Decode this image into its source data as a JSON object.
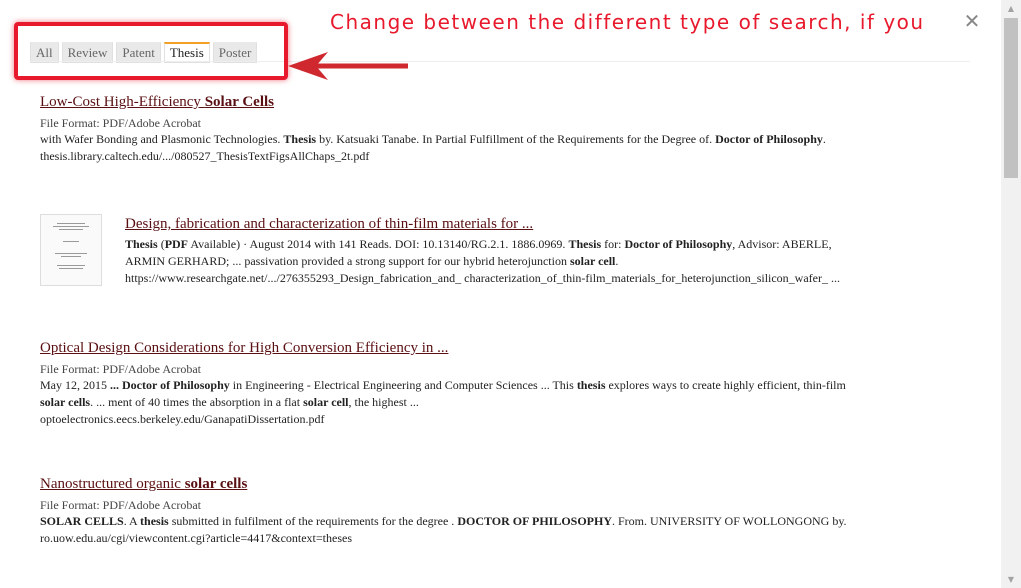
{
  "tabs": [
    {
      "label": "All",
      "active": false
    },
    {
      "label": "Review",
      "active": false
    },
    {
      "label": "Patent",
      "active": false
    },
    {
      "label": "Thesis",
      "active": true
    },
    {
      "label": "Poster",
      "active": false
    }
  ],
  "callout": {
    "text": "Change between the different type of search, if you",
    "color": "#e8192c"
  },
  "close_label": "✕",
  "results": [
    {
      "title_runs": [
        {
          "text": "Low-Cost High-Efficiency ",
          "bold": false
        },
        {
          "text": "Solar Cells",
          "bold": true
        }
      ],
      "format": "File Format: PDF/Adobe Acrobat",
      "snippet_lines": [
        [
          {
            "text": "with Wafer Bonding and Plasmonic Technologies. ",
            "bold": false
          },
          {
            "text": "Thesis",
            "bold": true
          },
          {
            "text": " by. Katsuaki Tanabe. In Partial Fulfillment of the Requirements for the Degree of. ",
            "bold": false
          },
          {
            "text": "Doctor of Philosophy",
            "bold": true
          },
          {
            "text": ".",
            "bold": false
          }
        ]
      ],
      "url": "thesis.library.caltech.edu/.../080527_ThesisTextFigsAllChaps_2t.pdf"
    },
    {
      "title_runs": [
        {
          "text": "Design, fabrication and characterization of thin-film materials for ...",
          "bold": false
        }
      ],
      "format": "",
      "has_thumbnail": true,
      "snippet_lines": [
        [
          {
            "text": "Thesis",
            "bold": true
          },
          {
            "text": " (",
            "bold": false
          },
          {
            "text": "PDF",
            "bold": true
          },
          {
            "text": " Available) · August 2014 with 141 Reads. DOI: 10.13140/RG.2.1. 1886.0969. ",
            "bold": false
          },
          {
            "text": "Thesis",
            "bold": true
          },
          {
            "text": " for: ",
            "bold": false
          },
          {
            "text": "Doctor of Philosophy",
            "bold": true
          },
          {
            "text": ", Advisor: ABERLE,",
            "bold": false
          }
        ],
        [
          {
            "text": "ARMIN GERHARD; ... passivation provided a strong support for our hybrid heterojunction ",
            "bold": false
          },
          {
            "text": "solar cell",
            "bold": true
          },
          {
            "text": ".",
            "bold": false
          }
        ]
      ],
      "url": "https://www.researchgate.net/.../276355293_Design_fabrication_and_ characterization_of_thin-film_materials_for_heterojunction_silicon_wafer_ ..."
    },
    {
      "title_runs": [
        {
          "text": "Optical Design Considerations for High Conversion Efficiency in ...",
          "bold": false
        }
      ],
      "format": "File Format: PDF/Adobe Acrobat",
      "snippet_lines": [
        [
          {
            "text": "May 12, 2015 ",
            "bold": false
          },
          {
            "text": "... Doctor of Philosophy",
            "bold": true
          },
          {
            "text": " in Engineering - Electrical Engineering and Computer Sciences ... This ",
            "bold": false
          },
          {
            "text": "thesis",
            "bold": true
          },
          {
            "text": " explores ways to create highly efficient, thin-film",
            "bold": false
          }
        ],
        [
          {
            "text": "solar cells",
            "bold": true
          },
          {
            "text": ". ... ment of 40 times the absorption in a flat ",
            "bold": false
          },
          {
            "text": "solar cell",
            "bold": true
          },
          {
            "text": ", the highest ...",
            "bold": false
          }
        ]
      ],
      "url": "optoelectronics.eecs.berkeley.edu/GanapatiDissertation.pdf"
    },
    {
      "title_runs": [
        {
          "text": "Nanostructured organic ",
          "bold": false
        },
        {
          "text": "solar cells",
          "bold": true
        }
      ],
      "format": "File Format: PDF/Adobe Acrobat",
      "snippet_lines": [
        [
          {
            "text": "SOLAR CELLS",
            "bold": true
          },
          {
            "text": ". A ",
            "bold": false
          },
          {
            "text": "thesis",
            "bold": true
          },
          {
            "text": " submitted in fulfilment of the requirements for the degree . ",
            "bold": false
          },
          {
            "text": "DOCTOR OF PHILOSOPHY",
            "bold": true
          },
          {
            "text": ". From. UNIVERSITY OF WOLLONGONG by.",
            "bold": false
          }
        ]
      ],
      "url": "ro.uow.edu.au/cgi/viewcontent.cgi?article=4417&context=theses"
    }
  ],
  "scrollbar": {
    "up_icon": "▲",
    "down_icon": "▼"
  }
}
